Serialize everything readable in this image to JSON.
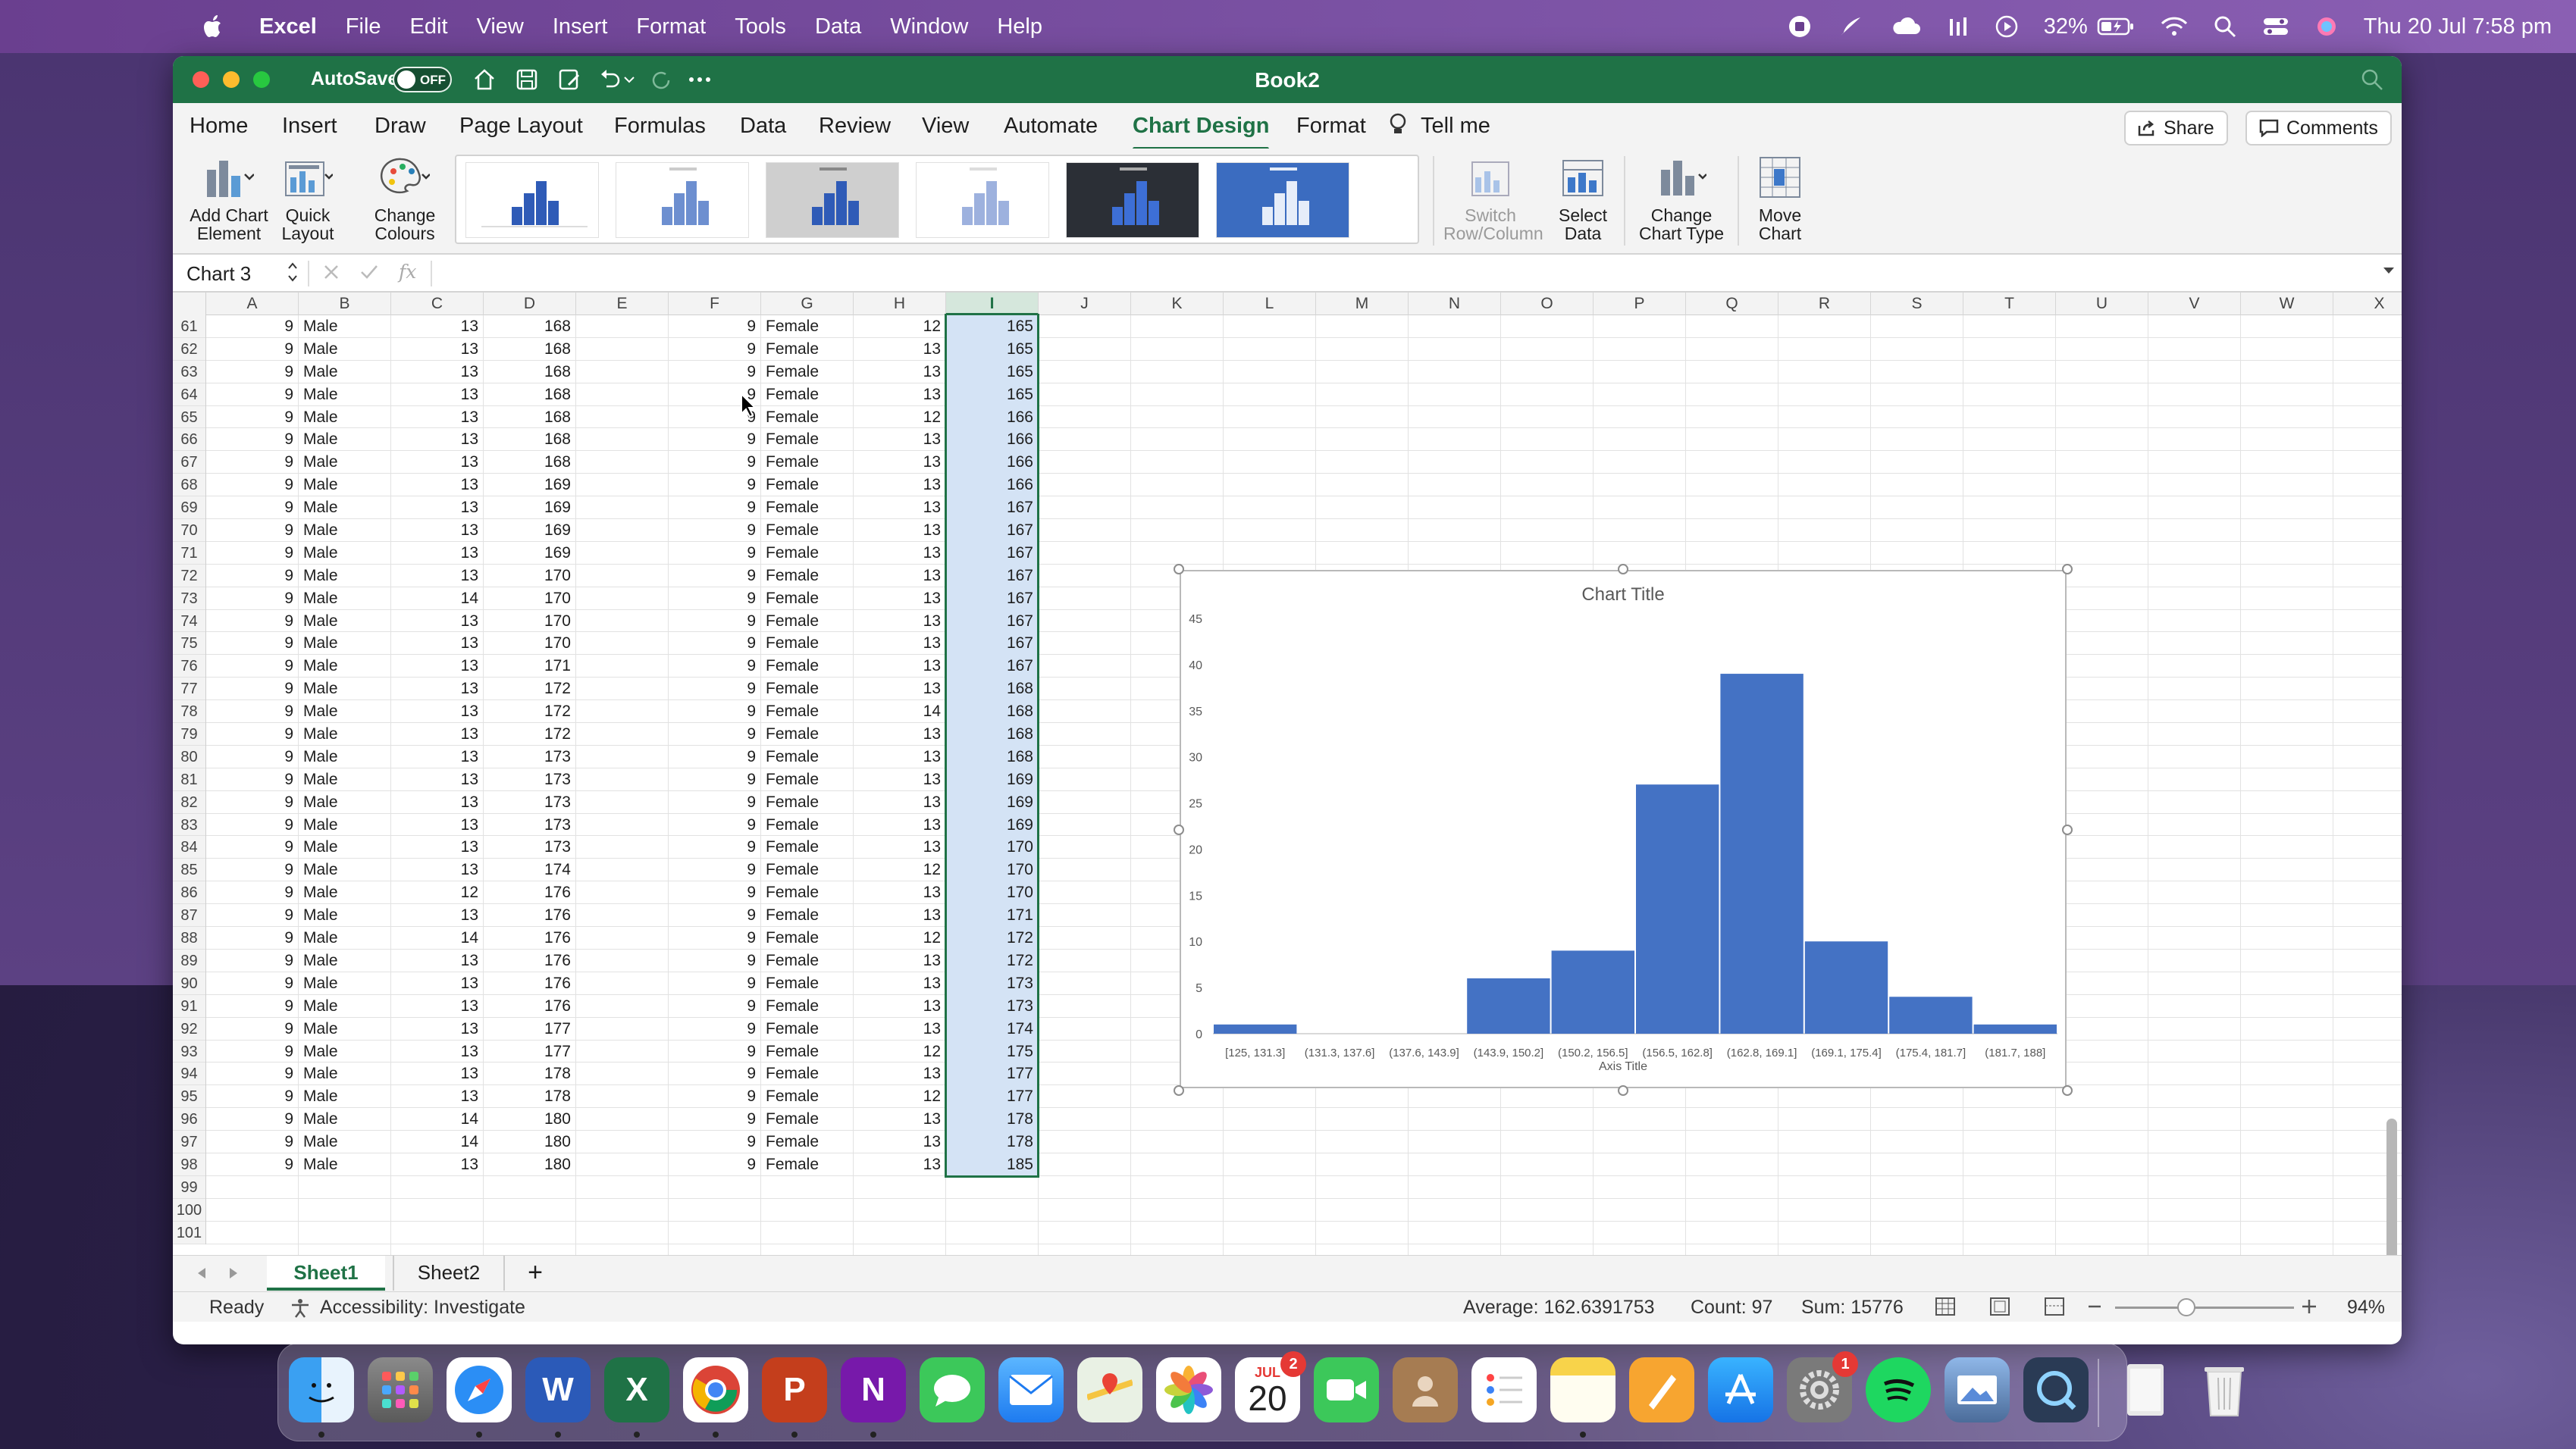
{
  "menubar": {
    "items": [
      "Excel",
      "File",
      "Edit",
      "View",
      "Insert",
      "Format",
      "Tools",
      "Data",
      "Window",
      "Help"
    ],
    "battery": "32%",
    "datetime": "Thu 20 Jul  7:58 pm"
  },
  "titlebar": {
    "autosave_label": "AutoSave",
    "autosave_state": "OFF",
    "doc_title": "Book2"
  },
  "tabs": {
    "items": [
      "Home",
      "Insert",
      "Draw",
      "Page Layout",
      "Formulas",
      "Data",
      "Review",
      "View",
      "Automate",
      "Chart Design",
      "Format",
      "Tell me"
    ],
    "active": "Chart Design",
    "share_label": "Share",
    "comments_label": "Comments"
  },
  "ribbon": {
    "add_chart_element": "Add Chart Element",
    "quick_layout": "Quick Layout",
    "change_colours": "Change Colours",
    "switch_row_column": "Switch Row/Column",
    "select_data": "Select Data",
    "change_chart_type": "Change Chart Type",
    "move_chart": "Move Chart"
  },
  "formula_bar": {
    "name_box": "Chart 3",
    "fx": "fx"
  },
  "columns": [
    "A",
    "B",
    "C",
    "D",
    "E",
    "F",
    "G",
    "H",
    "I",
    "J",
    "K",
    "L",
    "M",
    "N",
    "O",
    "P",
    "Q",
    "R",
    "S",
    "T",
    "U",
    "V",
    "W",
    "X"
  ],
  "rows": [
    {
      "n": "61",
      "A": "9",
      "B": "Male",
      "C": "13",
      "D": "168",
      "F": "9",
      "G": "Female",
      "H": "12",
      "I": "165"
    },
    {
      "n": "62",
      "A": "9",
      "B": "Male",
      "C": "13",
      "D": "168",
      "F": "9",
      "G": "Female",
      "H": "13",
      "I": "165"
    },
    {
      "n": "63",
      "A": "9",
      "B": "Male",
      "C": "13",
      "D": "168",
      "F": "9",
      "G": "Female",
      "H": "13",
      "I": "165"
    },
    {
      "n": "64",
      "A": "9",
      "B": "Male",
      "C": "13",
      "D": "168",
      "F": "9",
      "G": "Female",
      "H": "13",
      "I": "165"
    },
    {
      "n": "65",
      "A": "9",
      "B": "Male",
      "C": "13",
      "D": "168",
      "F": "9",
      "G": "Female",
      "H": "12",
      "I": "166"
    },
    {
      "n": "66",
      "A": "9",
      "B": "Male",
      "C": "13",
      "D": "168",
      "F": "9",
      "G": "Female",
      "H": "13",
      "I": "166"
    },
    {
      "n": "67",
      "A": "9",
      "B": "Male",
      "C": "13",
      "D": "168",
      "F": "9",
      "G": "Female",
      "H": "13",
      "I": "166"
    },
    {
      "n": "68",
      "A": "9",
      "B": "Male",
      "C": "13",
      "D": "169",
      "F": "9",
      "G": "Female",
      "H": "13",
      "I": "166"
    },
    {
      "n": "69",
      "A": "9",
      "B": "Male",
      "C": "13",
      "D": "169",
      "F": "9",
      "G": "Female",
      "H": "13",
      "I": "167"
    },
    {
      "n": "70",
      "A": "9",
      "B": "Male",
      "C": "13",
      "D": "169",
      "F": "9",
      "G": "Female",
      "H": "13",
      "I": "167"
    },
    {
      "n": "71",
      "A": "9",
      "B": "Male",
      "C": "13",
      "D": "169",
      "F": "9",
      "G": "Female",
      "H": "13",
      "I": "167"
    },
    {
      "n": "72",
      "A": "9",
      "B": "Male",
      "C": "13",
      "D": "170",
      "F": "9",
      "G": "Female",
      "H": "13",
      "I": "167"
    },
    {
      "n": "73",
      "A": "9",
      "B": "Male",
      "C": "14",
      "D": "170",
      "F": "9",
      "G": "Female",
      "H": "13",
      "I": "167"
    },
    {
      "n": "74",
      "A": "9",
      "B": "Male",
      "C": "13",
      "D": "170",
      "F": "9",
      "G": "Female",
      "H": "13",
      "I": "167"
    },
    {
      "n": "75",
      "A": "9",
      "B": "Male",
      "C": "13",
      "D": "170",
      "F": "9",
      "G": "Female",
      "H": "13",
      "I": "167"
    },
    {
      "n": "76",
      "A": "9",
      "B": "Male",
      "C": "13",
      "D": "171",
      "F": "9",
      "G": "Female",
      "H": "13",
      "I": "167"
    },
    {
      "n": "77",
      "A": "9",
      "B": "Male",
      "C": "13",
      "D": "172",
      "F": "9",
      "G": "Female",
      "H": "13",
      "I": "168"
    },
    {
      "n": "78",
      "A": "9",
      "B": "Male",
      "C": "13",
      "D": "172",
      "F": "9",
      "G": "Female",
      "H": "14",
      "I": "168"
    },
    {
      "n": "79",
      "A": "9",
      "B": "Male",
      "C": "13",
      "D": "172",
      "F": "9",
      "G": "Female",
      "H": "13",
      "I": "168"
    },
    {
      "n": "80",
      "A": "9",
      "B": "Male",
      "C": "13",
      "D": "173",
      "F": "9",
      "G": "Female",
      "H": "13",
      "I": "168"
    },
    {
      "n": "81",
      "A": "9",
      "B": "Male",
      "C": "13",
      "D": "173",
      "F": "9",
      "G": "Female",
      "H": "13",
      "I": "169"
    },
    {
      "n": "82",
      "A": "9",
      "B": "Male",
      "C": "13",
      "D": "173",
      "F": "9",
      "G": "Female",
      "H": "13",
      "I": "169"
    },
    {
      "n": "83",
      "A": "9",
      "B": "Male",
      "C": "13",
      "D": "173",
      "F": "9",
      "G": "Female",
      "H": "13",
      "I": "169"
    },
    {
      "n": "84",
      "A": "9",
      "B": "Male",
      "C": "13",
      "D": "173",
      "F": "9",
      "G": "Female",
      "H": "13",
      "I": "170"
    },
    {
      "n": "85",
      "A": "9",
      "B": "Male",
      "C": "13",
      "D": "174",
      "F": "9",
      "G": "Female",
      "H": "12",
      "I": "170"
    },
    {
      "n": "86",
      "A": "9",
      "B": "Male",
      "C": "12",
      "D": "176",
      "F": "9",
      "G": "Female",
      "H": "13",
      "I": "170"
    },
    {
      "n": "87",
      "A": "9",
      "B": "Male",
      "C": "13",
      "D": "176",
      "F": "9",
      "G": "Female",
      "H": "13",
      "I": "171"
    },
    {
      "n": "88",
      "A": "9",
      "B": "Male",
      "C": "14",
      "D": "176",
      "F": "9",
      "G": "Female",
      "H": "12",
      "I": "172"
    },
    {
      "n": "89",
      "A": "9",
      "B": "Male",
      "C": "13",
      "D": "176",
      "F": "9",
      "G": "Female",
      "H": "13",
      "I": "172"
    },
    {
      "n": "90",
      "A": "9",
      "B": "Male",
      "C": "13",
      "D": "176",
      "F": "9",
      "G": "Female",
      "H": "13",
      "I": "173"
    },
    {
      "n": "91",
      "A": "9",
      "B": "Male",
      "C": "13",
      "D": "176",
      "F": "9",
      "G": "Female",
      "H": "13",
      "I": "173"
    },
    {
      "n": "92",
      "A": "9",
      "B": "Male",
      "C": "13",
      "D": "177",
      "F": "9",
      "G": "Female",
      "H": "13",
      "I": "174"
    },
    {
      "n": "93",
      "A": "9",
      "B": "Male",
      "C": "13",
      "D": "177",
      "F": "9",
      "G": "Female",
      "H": "12",
      "I": "175"
    },
    {
      "n": "94",
      "A": "9",
      "B": "Male",
      "C": "13",
      "D": "178",
      "F": "9",
      "G": "Female",
      "H": "13",
      "I": "177"
    },
    {
      "n": "95",
      "A": "9",
      "B": "Male",
      "C": "13",
      "D": "178",
      "F": "9",
      "G": "Female",
      "H": "12",
      "I": "177"
    },
    {
      "n": "96",
      "A": "9",
      "B": "Male",
      "C": "14",
      "D": "180",
      "F": "9",
      "G": "Female",
      "H": "13",
      "I": "178"
    },
    {
      "n": "97",
      "A": "9",
      "B": "Male",
      "C": "14",
      "D": "180",
      "F": "9",
      "G": "Female",
      "H": "13",
      "I": "178"
    },
    {
      "n": "98",
      "A": "9",
      "B": "Male",
      "C": "13",
      "D": "180",
      "F": "9",
      "G": "Female",
      "H": "13",
      "I": "185"
    },
    {
      "n": "99"
    },
    {
      "n": "100"
    },
    {
      "n": "101"
    }
  ],
  "chart_data": {
    "type": "bar",
    "title": "Chart Title",
    "xlabel": "Axis Title",
    "ylabel": "",
    "categories": [
      "[125, 131.3]",
      "(131.3, 137.6]",
      "(137.6, 143.9]",
      "(143.9, 150.2]",
      "(150.2, 156.5]",
      "(156.5, 162.8]",
      "(162.8, 169.1]",
      "(169.1, 175.4]",
      "(175.4, 181.7]",
      "(181.7, 188]"
    ],
    "values": [
      1,
      0,
      0,
      6,
      9,
      27,
      39,
      10,
      4,
      1
    ],
    "ylim": [
      0,
      45
    ],
    "yticks": [
      0,
      5,
      10,
      15,
      20,
      25,
      30,
      35,
      40,
      45
    ],
    "bar_color": "#4472c4",
    "grid": false
  },
  "sheets": {
    "tabs": [
      "Sheet1",
      "Sheet2"
    ],
    "active": "Sheet1",
    "add": "+"
  },
  "status": {
    "ready": "Ready",
    "accessibility": "Accessibility: Investigate",
    "average": "Average: 162.6391753",
    "count": "Count: 97",
    "sum": "Sum: 15776",
    "zoom": "94%"
  },
  "dock": {
    "calendar_month": "JUL",
    "calendar_day": "20",
    "calendar_badge": "2",
    "settings_badge": "1"
  },
  "colors": {
    "excel_green": "#1f7246",
    "accent_blue": "#4472c4"
  }
}
